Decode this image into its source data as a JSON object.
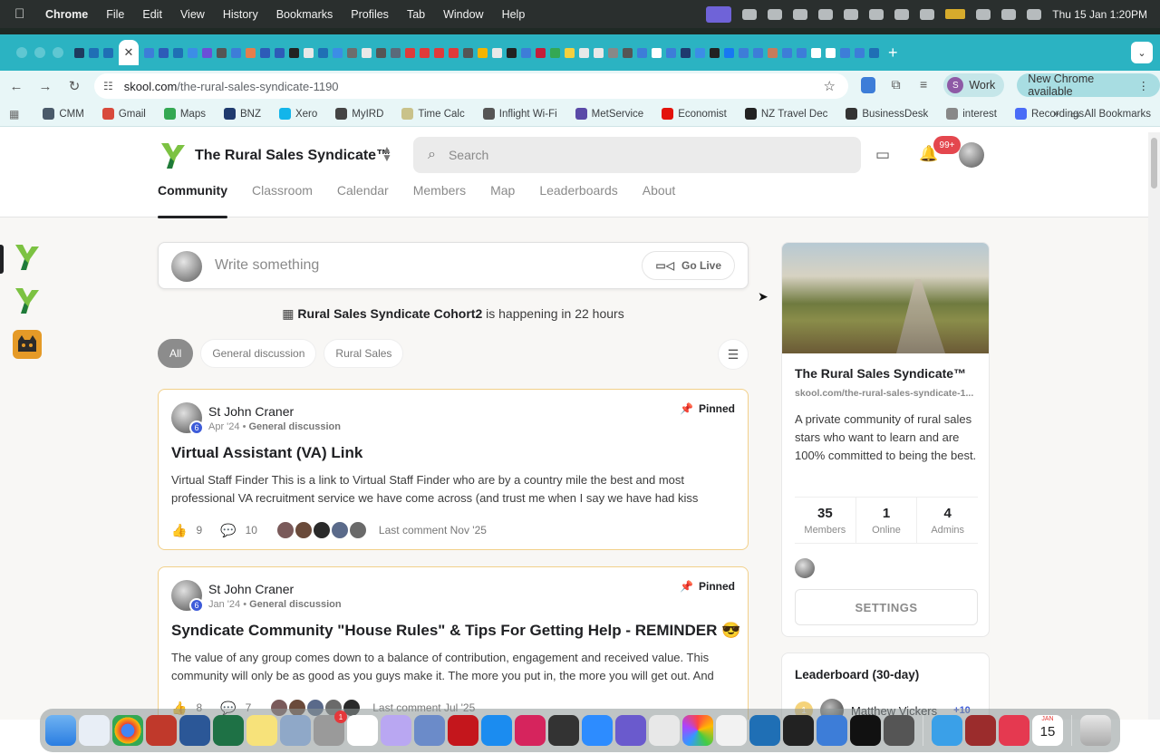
{
  "menubar": {
    "apple": "",
    "items": [
      "Chrome",
      "File",
      "Edit",
      "View",
      "History",
      "Bookmarks",
      "Profiles",
      "Tab",
      "Window",
      "Help"
    ],
    "clock": "Thu 15 Jan  1:20PM"
  },
  "browser": {
    "url_domain": "skool.com",
    "url_path": "/the-rural-sales-syndicate-1190",
    "profile_initial": "S",
    "profile_label": "Work",
    "update_label": "New Chrome available",
    "bookmarks": [
      {
        "label": "CMM",
        "color": "#4a5a6a"
      },
      {
        "label": "Gmail",
        "color": "#d84a3c"
      },
      {
        "label": "Maps",
        "color": "#34a853"
      },
      {
        "label": "BNZ",
        "color": "#1f3a6e"
      },
      {
        "label": "Xero",
        "color": "#13b5ea"
      },
      {
        "label": "MyIRD",
        "color": "#444444"
      },
      {
        "label": "Time Calc",
        "color": "#c9c28a"
      },
      {
        "label": "Inflight Wi-Fi",
        "color": "#555555"
      },
      {
        "label": "MetService",
        "color": "#5a4aa8"
      },
      {
        "label": "Economist",
        "color": "#e3120b"
      },
      {
        "label": "NZ Travel Dec",
        "color": "#222222"
      },
      {
        "label": "BusinessDesk",
        "color": "#333333"
      },
      {
        "label": "interest",
        "color": "#888888"
      },
      {
        "label": "Recordings",
        "color": "#4a6cf7"
      }
    ],
    "all_bookmarks": "All Bookmarks"
  },
  "site": {
    "brand": "The Rural Sales Syndicate™",
    "search_placeholder": "Search",
    "notifications": "99+",
    "tabs": [
      "Community",
      "Classroom",
      "Calendar",
      "Members",
      "Map",
      "Leaderboards",
      "About"
    ]
  },
  "composer": {
    "placeholder": "Write something",
    "go_live": "Go Live"
  },
  "event": {
    "name": "Rural Sales Syndicate Cohort2",
    "suffix": " is happening in 22 hours"
  },
  "filters": [
    "All",
    "General discussion",
    "Rural Sales"
  ],
  "posts": [
    {
      "author": "St John Craner",
      "level": "6",
      "date": "Apr '24",
      "category": "General discussion",
      "pinned": "Pinned",
      "title": "Virtual Assistant (VA) Link",
      "body": "Virtual Staff Finder This is a link to Virtual Staff Finder who are by a country mile the best and most professional VA recruitment service we have come across (and trust me when I say we have had kiss",
      "likes": "9",
      "comments": "10",
      "last_comment": "Last comment Nov '25"
    },
    {
      "author": "St John Craner",
      "level": "6",
      "date": "Jan '24",
      "category": "General discussion",
      "pinned": "Pinned",
      "title": "Syndicate Community \"House Rules\" & Tips For Getting Help - REMINDER 😎",
      "body": "The value of any group comes down to a balance of contribution, engagement and received value. This community will only be as good as you guys make it. The more you put in, the more you will get out. And",
      "likes": "8",
      "comments": "7",
      "last_comment": "Last comment Jul '25"
    }
  ],
  "sidebar": {
    "title": "The Rural Sales Syndicate™",
    "url": "skool.com/the-rural-sales-syndicate-1...",
    "description": "A private community of rural sales stars who want to learn and are 100% committed to being the best.",
    "stats": [
      {
        "value": "35",
        "label": "Members"
      },
      {
        "value": "1",
        "label": "Online"
      },
      {
        "value": "4",
        "label": "Admins"
      }
    ],
    "settings": "SETTINGS"
  },
  "leaderboard": {
    "title": "Leaderboard (30-day)",
    "rank": "1",
    "name": "Matthew Vickers",
    "points": "+10"
  },
  "dock_badges": {
    "settings": "1",
    "calendar_month": "JAN",
    "calendar_day": "15"
  }
}
